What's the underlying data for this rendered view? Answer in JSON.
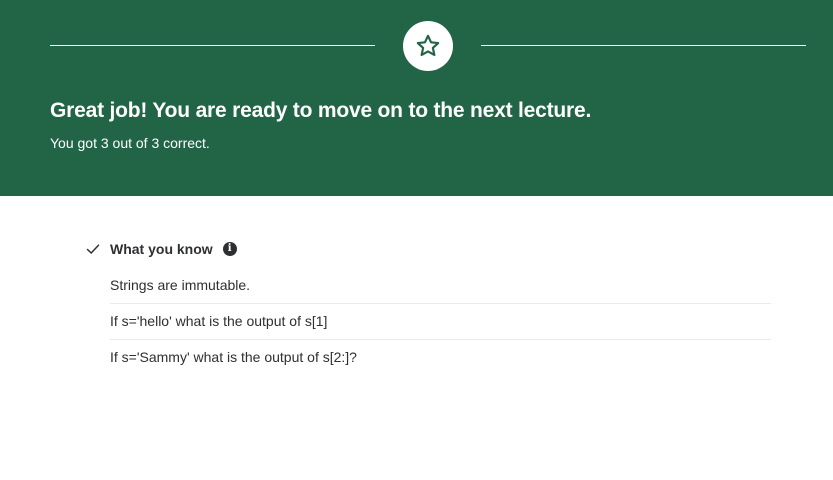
{
  "banner": {
    "icon": "star-icon",
    "headline": "Great job! You are ready to move on to the next lecture.",
    "score_text": "You got 3 out of 3 correct.",
    "background_color": "#216546"
  },
  "results": {
    "section_icon": "check-icon",
    "section_title": "What you know",
    "info_icon": "info-icon",
    "questions": [
      "Strings are immutable.",
      "If s='hello' what is the output of s[1]",
      "If s='Sammy' what is the output of s[2:]?"
    ]
  }
}
